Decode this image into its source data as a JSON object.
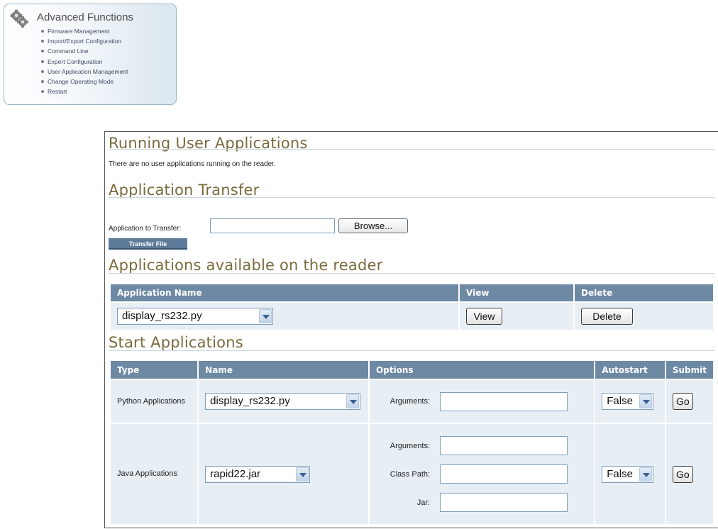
{
  "menu": {
    "title": "Advanced Functions",
    "items": [
      "Firmware Management",
      "Import/Export Configuration",
      "Command Line",
      "Expert Configuration",
      "User Application Management",
      "Change Operating Mode",
      "Restart"
    ]
  },
  "running": {
    "title": "Running User Applications",
    "message": "There are no user applications running on the reader."
  },
  "transfer": {
    "title": "Application Transfer",
    "field_label": "Application to Transfer:",
    "field_value": "",
    "browse_label": "Browse...",
    "transfer_label": "Transfer File"
  },
  "available": {
    "title": "Applications available on the reader",
    "columns": [
      "Application Name",
      "View",
      "Delete"
    ],
    "selected_app": "display_rs232.py",
    "view_label": "View",
    "delete_label": "Delete"
  },
  "start": {
    "title": "Start Applications",
    "columns": [
      "Type",
      "Name",
      "Options",
      "Autostart",
      "Submit"
    ],
    "python": {
      "type_label": "Python Applications",
      "selected": "display_rs232.py",
      "arguments_label": "Arguments:",
      "arguments_value": "",
      "autostart": "False",
      "go_label": "Go"
    },
    "java": {
      "type_label": "Java Applications",
      "selected": "rapid22.jar",
      "arguments_label": "Arguments:",
      "arguments_value": "",
      "classpath_label": "Class Path:",
      "classpath_value": "",
      "jar_label": "Jar:",
      "jar_value": "",
      "autostart": "False",
      "go_label": "Go"
    }
  }
}
